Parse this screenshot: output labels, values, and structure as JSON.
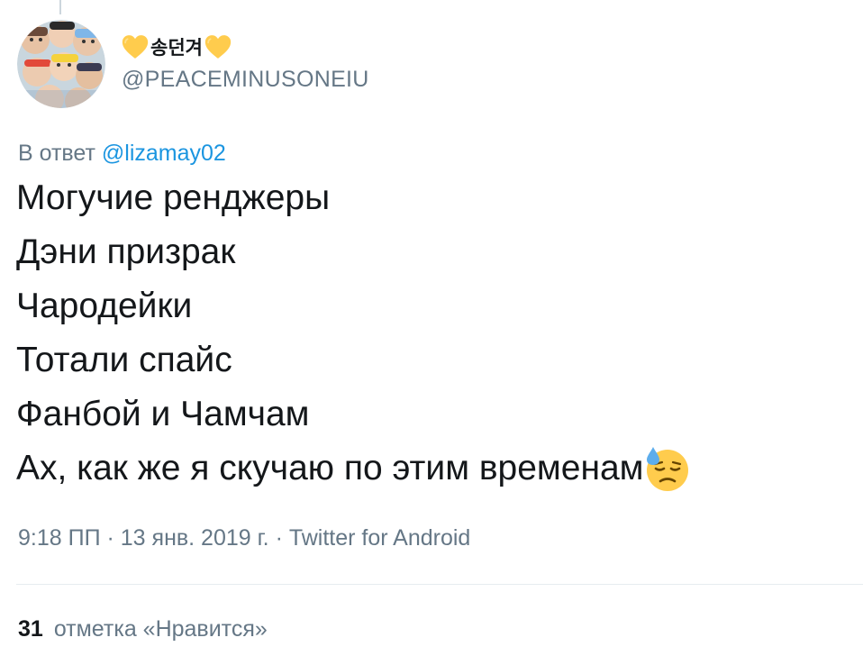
{
  "tweet": {
    "author": {
      "display_name": "송던겨",
      "name_decoration_icon": "yellow-heart-icon",
      "handle": "@PEACEMINUSONEIU"
    },
    "reply": {
      "prefix": "В ответ",
      "handle": "@lizamay02"
    },
    "lines": [
      "Могучие ренджеры",
      "Дэни призрак",
      "Чародейки",
      "Тотали спайс",
      "Фанбой и Чамчам",
      "Ах, как же я скучаю по этим временам"
    ],
    "trailing_emoji": "downcast-face-with-sweat-icon",
    "meta": {
      "time": "9:18 ПП",
      "separator": "·",
      "date": "13 янв. 2019 г.",
      "source": "Twitter for Android"
    },
    "likes": {
      "count": "31",
      "label": "отметка «Нравится»"
    }
  },
  "colors": {
    "text_primary": "#14171a",
    "text_secondary": "#657786",
    "link": "#1b95e0",
    "divider": "#e6ecf0",
    "heart": "#ffcc4d"
  }
}
